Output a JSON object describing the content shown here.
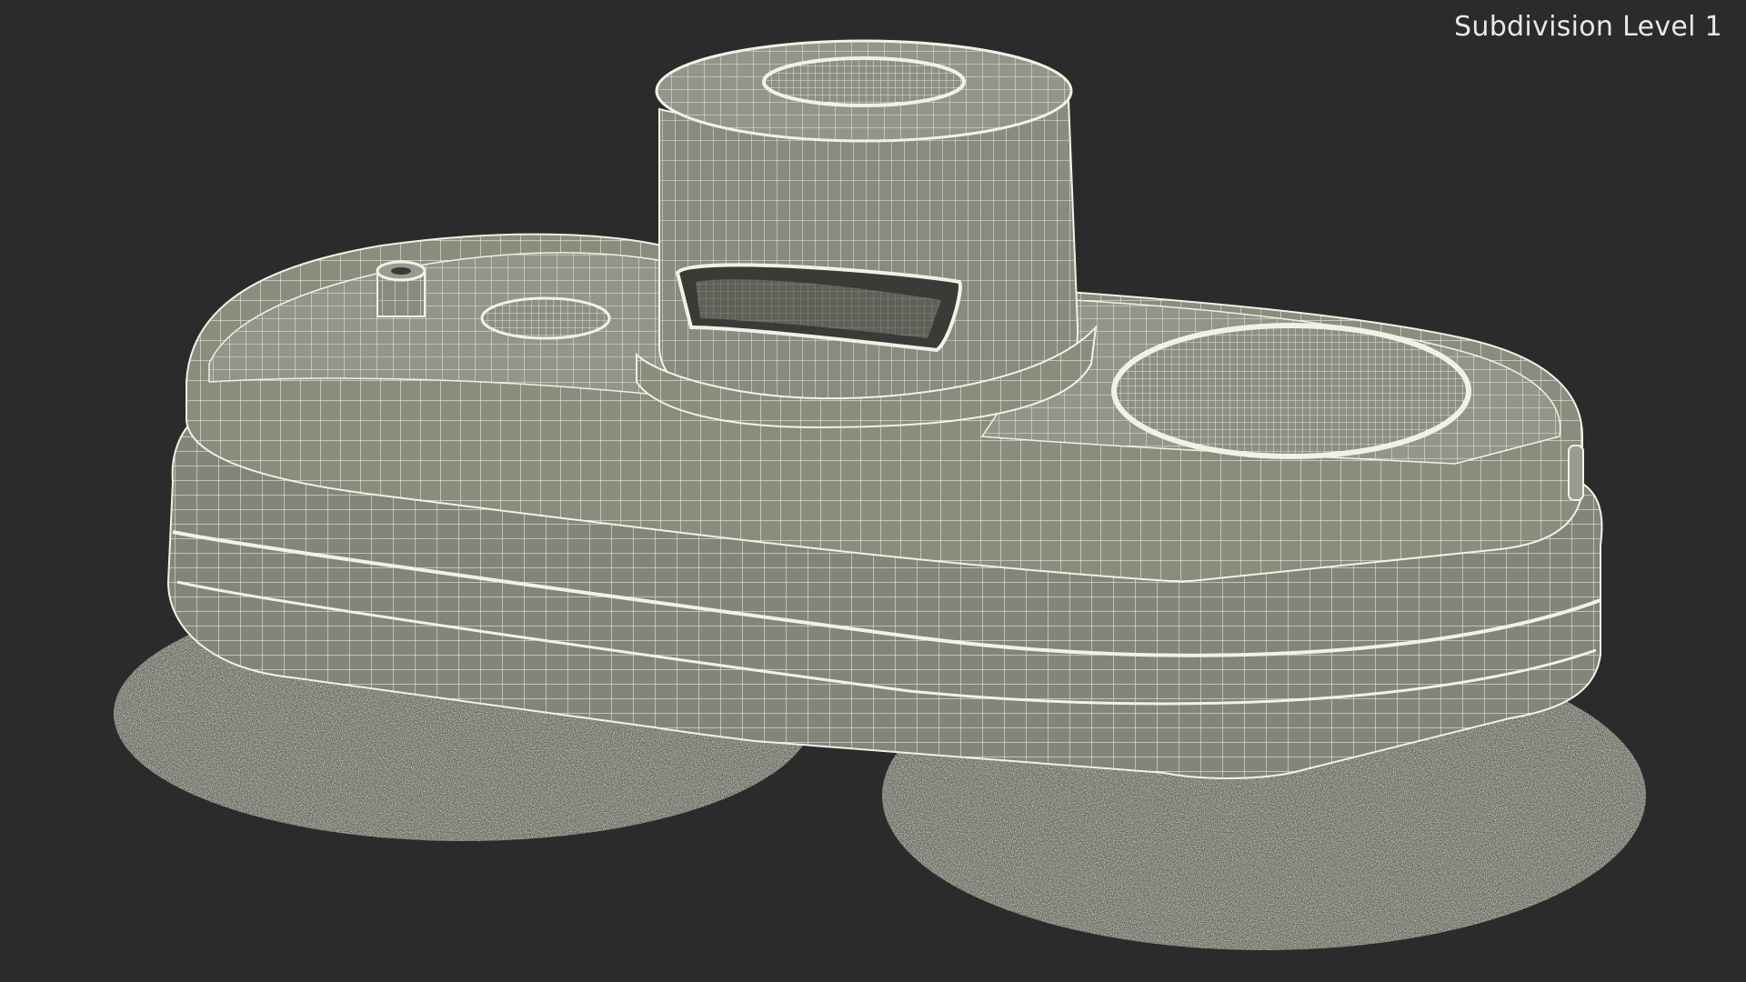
{
  "overlay": {
    "label": "Subdivision Level 1"
  },
  "scene": {
    "background_color": "#2b2b2b",
    "body_color": "#8b8c7d",
    "wire_color": "#f2f1e6",
    "pad_color": "#6f7066"
  }
}
